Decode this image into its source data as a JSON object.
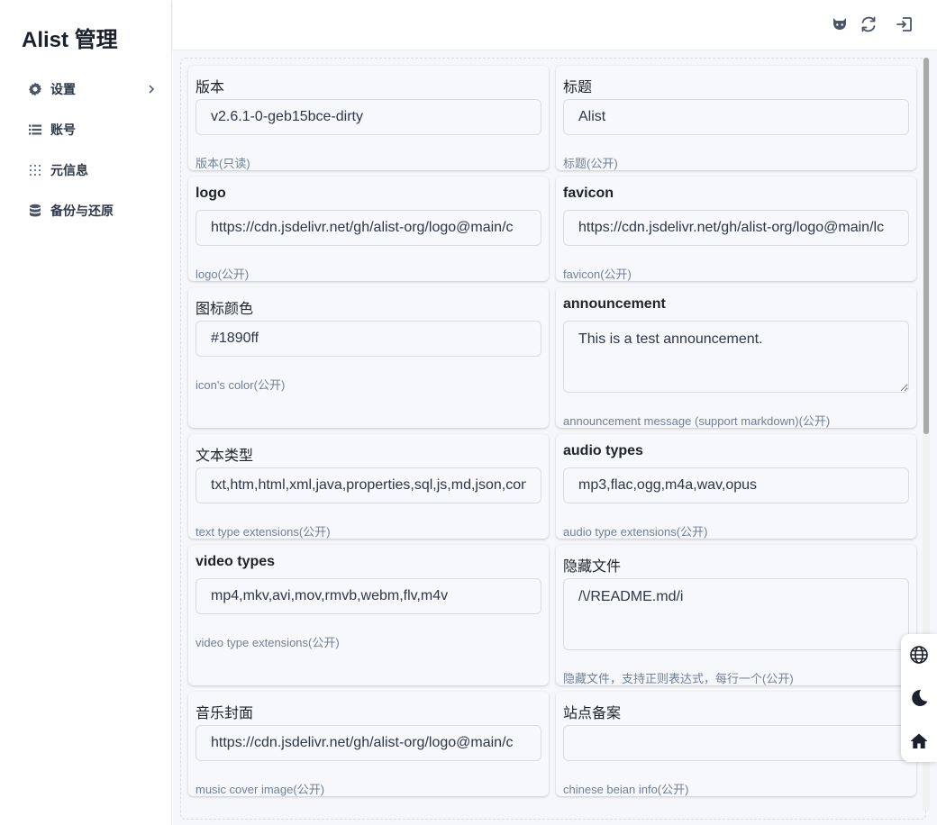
{
  "app": {
    "title": "Alist 管理"
  },
  "sidebar": {
    "items": [
      {
        "label": "设置",
        "icon": "gear-icon"
      },
      {
        "label": "账号",
        "icon": "list-icon"
      },
      {
        "label": "元信息",
        "icon": "meta-grid-icon"
      },
      {
        "label": "备份与还原",
        "icon": "database-icon"
      }
    ]
  },
  "topbar": {
    "icons": [
      "github-icon",
      "refresh-icon",
      "logout-icon"
    ]
  },
  "float_tools": {
    "icons": [
      "globe-icon",
      "moon-icon",
      "home-icon"
    ]
  },
  "settings": [
    {
      "label": "版本",
      "value": "v2.6.1-0-geb15bce-dirty",
      "help": "版本(只读)",
      "placeholder": ""
    },
    {
      "label": "标题",
      "value": "Alist",
      "help": "标题(公开)",
      "placeholder": ""
    },
    {
      "label": "logo",
      "value": "https://cdn.jsdelivr.net/gh/alist-org/logo@main/c",
      "help": "logo(公开)",
      "placeholder": ""
    },
    {
      "label": "favicon",
      "value": "https://cdn.jsdelivr.net/gh/alist-org/logo@main/lc",
      "help": "favicon(公开)",
      "placeholder": ""
    },
    {
      "label": "图标颜色",
      "value": "#1890ff",
      "help": "icon's color(公开)",
      "placeholder": ""
    },
    {
      "label": "announcement",
      "value": "This is a test announcement.",
      "help": "announcement message (support markdown)(公开)",
      "placeholder": ""
    },
    {
      "label": "文本类型",
      "value": "txt,htm,html,xml,java,properties,sql,js,md,json,conf",
      "help": "text type extensions(公开)",
      "placeholder": ""
    },
    {
      "label": "audio types",
      "value": "mp3,flac,ogg,m4a,wav,opus",
      "help": "audio type extensions(公开)",
      "placeholder": ""
    },
    {
      "label": "video types",
      "value": "mp4,mkv,avi,mov,rmvb,webm,flv,m4v",
      "help": "video type extensions(公开)",
      "placeholder": ""
    },
    {
      "label": "隐藏文件",
      "value": "/\\/README.md/i",
      "help": "隐藏文件，支持正则表达式，每行一个(公开)",
      "placeholder": ""
    },
    {
      "label": "音乐封面",
      "value": "https://cdn.jsdelivr.net/gh/alist-org/logo@main/c",
      "help": "music cover image(公开)",
      "placeholder": ""
    },
    {
      "label": "站点备案",
      "value": "",
      "help": "chinese beian info(公开)",
      "placeholder": ""
    }
  ],
  "colors": {
    "accent": "#1890ff",
    "card_bg": "#f6f8fb",
    "content_bg": "#f5f7fa"
  }
}
